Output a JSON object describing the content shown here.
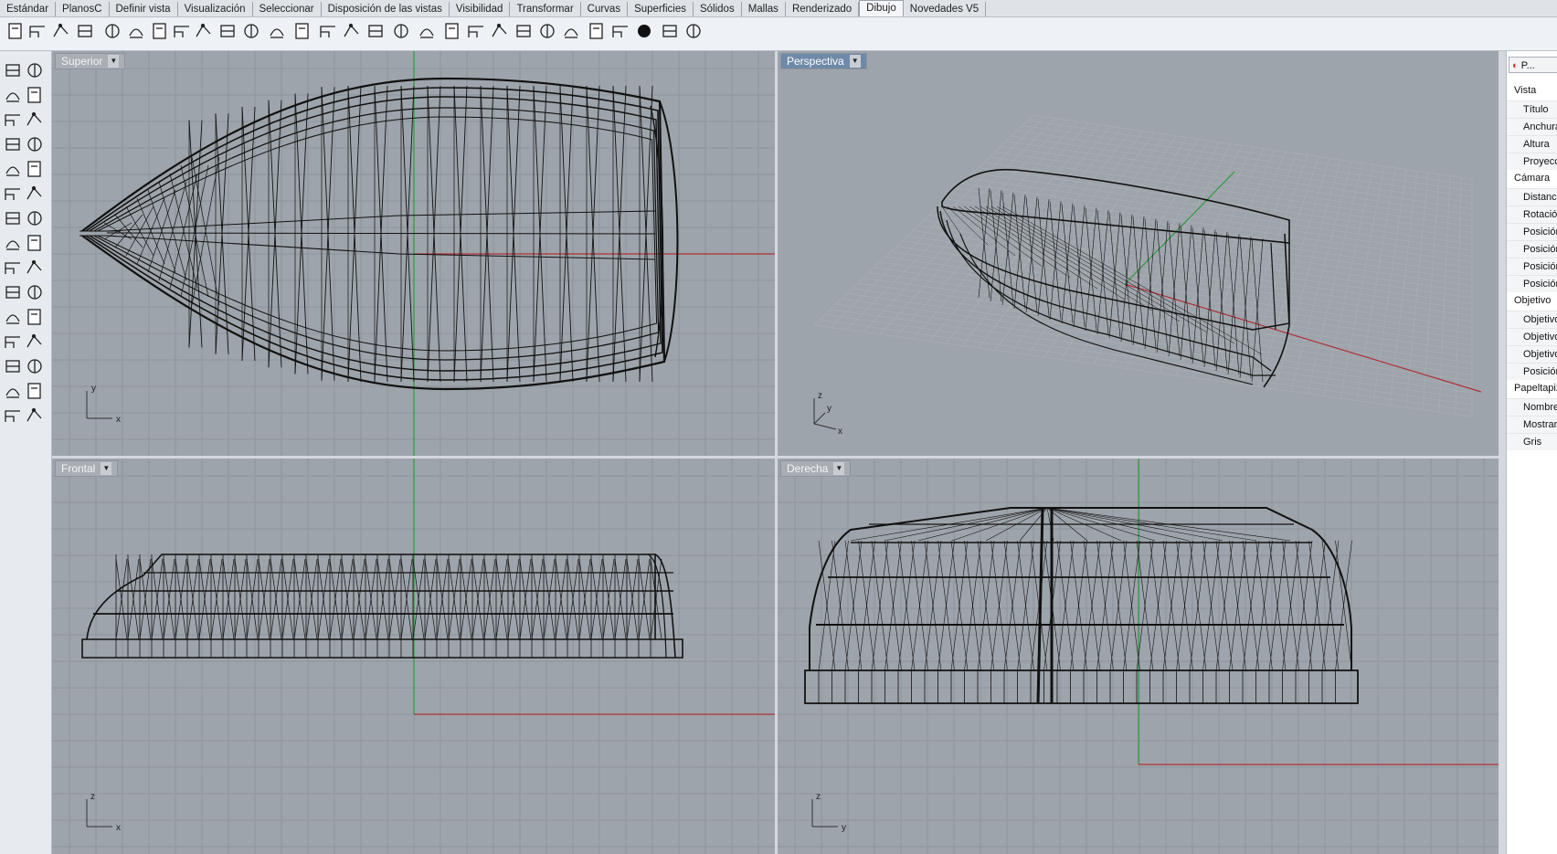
{
  "tabs": [
    "Estándar",
    "PlanosC",
    "Definir vista",
    "Visualización",
    "Seleccionar",
    "Disposición de las vistas",
    "Visibilidad",
    "Transformar",
    "Curvas",
    "Superficies",
    "Sólidos",
    "Mallas",
    "Renderizado",
    "Dibujo",
    "Novedades V5"
  ],
  "active_tab": "Dibujo",
  "toolbar_icons": [
    "new-file-icon",
    "open-file-icon",
    "save-icon",
    "print-icon",
    "dim-linear-icon",
    "dim-aligned-icon",
    "dim-rotated-icon",
    "dim-angle-icon",
    "dim-angle2-icon",
    "dim-45-icon",
    "dim-radius-icon",
    "dim-diameter-icon",
    "text-icon",
    "leader-icon",
    "leader2-icon",
    "dim-horizontal-icon",
    "dim-arc-icon",
    "hatch-icon",
    "hatch2-icon",
    "block-icon",
    "annotation-icon",
    "text-tool-icon",
    "text-dot-icon",
    "text-object-icon",
    "box-icon",
    "grid-table-icon",
    "sphere-icon",
    "print2-icon",
    "layers-icon"
  ],
  "left_tool_icons": [
    "select-icon",
    "point-icon",
    "curve-icon",
    "plane-icon",
    "explode-icon",
    "trim-icon",
    "rectangle-icon",
    "polyline-icon",
    "circle-icon",
    "arc-icon",
    "ellipse-icon",
    "polygon-icon",
    "offset-icon",
    "fillet-icon",
    "extend-icon",
    "chamfer-icon",
    "surface-icon",
    "loft-icon",
    "revolve-icon",
    "sweep-icon",
    "boolean-icon",
    "cap-icon",
    "box-icon",
    "cylinder-icon",
    "mesh-icon",
    "analyze-icon",
    "dimension-icon",
    "snap-icon",
    "gear-icon",
    "move-icon"
  ],
  "viewports": {
    "top": {
      "label": "Superior",
      "axis_h": "x",
      "axis_v": "y"
    },
    "perspective": {
      "label": "Perspectiva",
      "axis_h": "x",
      "axis_v": "z",
      "axis_d": "y"
    },
    "front": {
      "label": "Frontal",
      "axis_h": "x",
      "axis_v": "z"
    },
    "right": {
      "label": "Derecha",
      "axis_h": "y",
      "axis_v": "z"
    }
  },
  "properties": {
    "tab_label": "P...",
    "sections": [
      {
        "title": "Vista",
        "items": [
          "Título",
          "Anchura",
          "Altura",
          "Proyecc"
        ]
      },
      {
        "title": "Cámara",
        "items": [
          "Distanci",
          "Rotació",
          "Posición",
          "Posición",
          "Posición",
          "Posición"
        ]
      },
      {
        "title": "Objetivo",
        "items": [
          "Objetivo",
          "Objetivo",
          "Objetivo",
          "Posición"
        ]
      },
      {
        "title": "Papeltapiz",
        "items": [
          "Nombre",
          "Mostrar",
          "Gris"
        ]
      }
    ]
  },
  "colors": {
    "viewport_bg": "#9ea4ab",
    "grid": "#8f959c",
    "x_axis": "#b03038",
    "y_axis": "#2e9a3c",
    "wire": "#111111"
  }
}
